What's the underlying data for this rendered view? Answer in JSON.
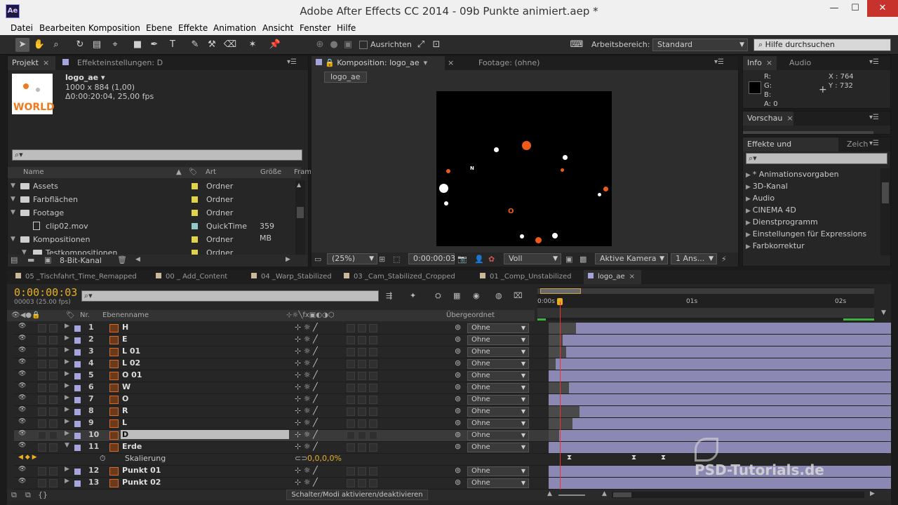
{
  "window": {
    "title": "Adobe After Effects CC 2014 - 09b Punkte animiert.aep *",
    "logo": "Ae",
    "min": "—",
    "max": "☐",
    "close": "✕"
  },
  "menu": [
    "Datei",
    "Bearbeiten",
    "Komposition",
    "Ebene",
    "Effekte",
    "Animation",
    "Ansicht",
    "Fenster",
    "Hilfe"
  ],
  "toolbar": {
    "snap_label": "Ausrichten",
    "workspace_label": "Arbeitsbereich:",
    "workspace_value": "Standard",
    "search_placeholder": "Hilfe durchsuchen"
  },
  "project": {
    "tab_project": "Projekt",
    "tab_effects": "Effekteinstellungen: D",
    "item_name": "logo_ae ▾",
    "item_size": "1000 x 884 (1,00)",
    "item_duration": "Δ0:00:20:04, 25,00 fps",
    "thumb_text": "WORLD",
    "search_icon": "⌕▾",
    "columns": {
      "name": "Name",
      "type": "Art",
      "size": "Größe",
      "frame": "Fram"
    },
    "rows": [
      {
        "name": "Assets",
        "type": "Ordner",
        "size": "",
        "color": "#e0d24a",
        "kind": "folder",
        "indent": 0
      },
      {
        "name": "Farbflächen",
        "type": "Ordner",
        "size": "",
        "color": "#e0d24a",
        "kind": "folder",
        "indent": 0
      },
      {
        "name": "Footage",
        "type": "Ordner",
        "size": "",
        "color": "#e0d24a",
        "kind": "folder",
        "indent": 0
      },
      {
        "name": "clip02.mov",
        "type": "QuickTime",
        "size": "359 MB",
        "color": "#8fc9c9",
        "kind": "file",
        "indent": 1
      },
      {
        "name": "Kompositionen",
        "type": "Ordner",
        "size": "",
        "color": "#e0d24a",
        "kind": "folder",
        "indent": 0
      },
      {
        "name": "Testkompositionen",
        "type": "Ordner",
        "size": "",
        "color": "#e0d24a",
        "kind": "folder",
        "indent": 1
      }
    ],
    "bitdepth": "8-Bit-Kanal"
  },
  "comp": {
    "tab_comp": "Komposition: logo_ae",
    "tab_footage": "Footage: (ohne)",
    "breadcrumb": "logo_ae",
    "zoom": "(25%)",
    "time": "0:00:00:03",
    "resolution": "Voll",
    "camera": "Aktive Kamera",
    "views": "1 Ans...",
    "letters": {
      "n": "N",
      "o": "O"
    }
  },
  "info": {
    "tab_info": "Info",
    "tab_audio": "Audio",
    "r": "R:",
    "g": "G:",
    "b": "B:",
    "a": "A:  0",
    "x": "X : 764",
    "y": "Y : 732"
  },
  "preview": {
    "tab": "Vorschau"
  },
  "effects": {
    "tab": "Effekte und Vorgaben",
    "tab2": "Zeich",
    "items": [
      "* Animationsvorgaben",
      "3D-Kanal",
      "Audio",
      "CINEMA 4D",
      "Dienstprogramm",
      "Einstellungen für Expressions",
      "Farbkorrektur"
    ]
  },
  "timeline": {
    "tabs": [
      "05 _Tischfahrt_Time_Remapped",
      "00 _ Add_Content",
      "04 _Warp_Stabilized",
      "03 _Cam_Stabilized_Cropped",
      "01 _Comp_Unstabilized",
      "logo_ae"
    ],
    "timecode": "0:00:00:03",
    "frame_info": "00003 (25.00 fps)",
    "col_nr": "Nr.",
    "col_name": "Ebenenname",
    "col_parent": "Übergeordnet",
    "ruler": [
      "0:00s",
      "01s",
      "02s"
    ],
    "layers": [
      {
        "nr": "1",
        "name": "H",
        "parent": "Ohne",
        "start": 0.08
      },
      {
        "nr": "2",
        "name": "E",
        "parent": "Ohne",
        "start": 0.04
      },
      {
        "nr": "3",
        "name": "L 01",
        "parent": "Ohne",
        "start": 0.05
      },
      {
        "nr": "4",
        "name": "L 02",
        "parent": "Ohne",
        "start": 0.02
      },
      {
        "nr": "5",
        "name": "O 01",
        "parent": "Ohne",
        "start": 0.0
      },
      {
        "nr": "6",
        "name": "W",
        "parent": "Ohne",
        "start": 0.06
      },
      {
        "nr": "7",
        "name": "O",
        "parent": "Ohne",
        "start": 0.0
      },
      {
        "nr": "8",
        "name": "R",
        "parent": "Ohne",
        "start": 0.09
      },
      {
        "nr": "9",
        "name": "L",
        "parent": "Ohne",
        "start": 0.07
      },
      {
        "nr": "10",
        "name": "D",
        "parent": "Ohne",
        "start": 0.03
      },
      {
        "nr": "11",
        "name": "Erde",
        "parent": "Ohne",
        "start": 0.0
      }
    ],
    "sub_property": {
      "name": "Skalierung",
      "value": "0,0,0,0%"
    },
    "layers_after": [
      {
        "nr": "12",
        "name": "Punkt 01",
        "parent": "Ohne"
      },
      {
        "nr": "13",
        "name": "Punkt 02",
        "parent": "Ohne"
      }
    ],
    "bottom_toggle": "Schalter/Modi aktivieren/deaktivieren"
  },
  "watermark": "PSD-Tutorials.de"
}
